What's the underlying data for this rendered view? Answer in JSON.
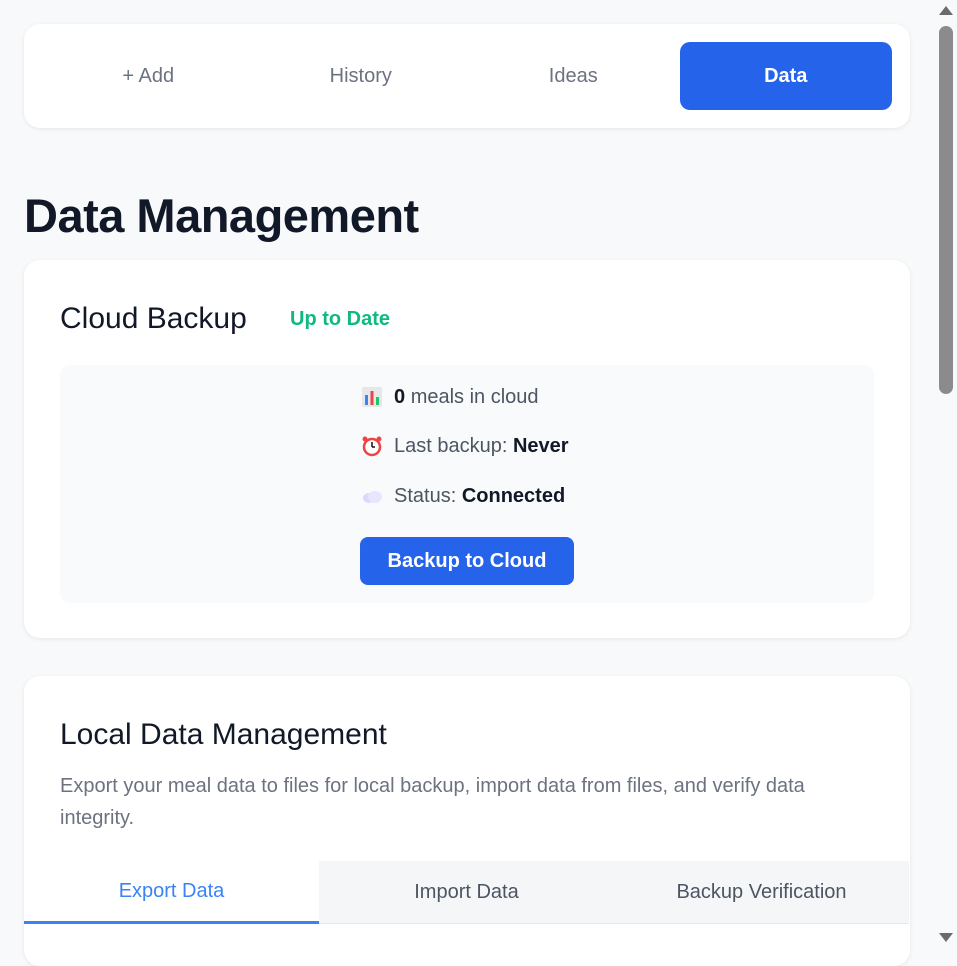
{
  "nav": {
    "tabs": [
      {
        "label": "+ Add"
      },
      {
        "label": "History"
      },
      {
        "label": "Ideas"
      },
      {
        "label": "Data"
      }
    ]
  },
  "page_title": "Data Management",
  "cloud": {
    "title": "Cloud Backup",
    "status": "Up to Date",
    "meals_count": "0",
    "meals_label": "meals in cloud",
    "last_backup_label": "Last backup:",
    "last_backup_value": "Never",
    "status_label": "Status:",
    "status_value": "Connected",
    "backup_button": "Backup to Cloud",
    "icons": [
      "bar-chart-icon",
      "alarm-clock-icon",
      "cloud-icon"
    ],
    "status_color": "#10b981"
  },
  "local": {
    "title": "Local Data Management",
    "description": "Export your meal data to files for local backup, import data from files, and verify data integrity.",
    "tabs": [
      {
        "label": "Export Data"
      },
      {
        "label": "Import Data"
      },
      {
        "label": "Backup Verification"
      }
    ]
  },
  "colors": {
    "accent": "#2563eb",
    "success": "#10b981"
  }
}
